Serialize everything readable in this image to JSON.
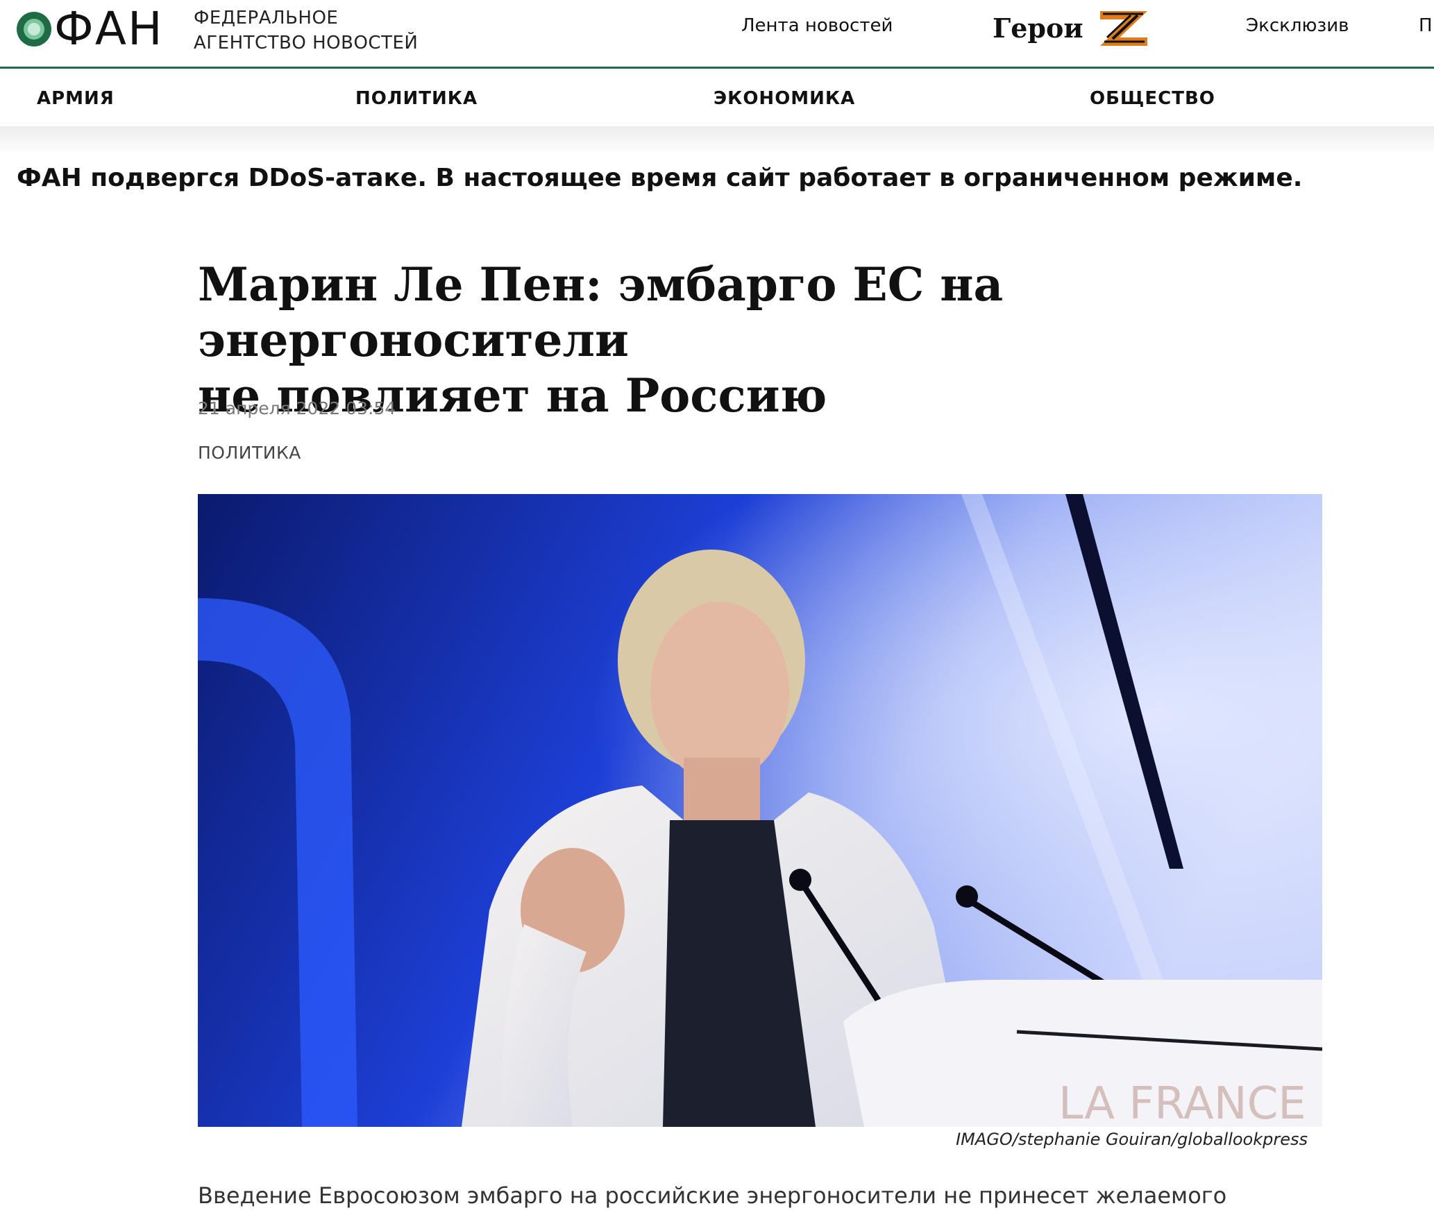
{
  "header": {
    "logo_text": "ФАН",
    "tagline_line1": "ФЕДЕРАЛЬНОЕ",
    "tagline_line2": "АГЕНТСТВО НОВОСТЕЙ",
    "links": {
      "news_feed": "Лента новостей",
      "heroes": "Герои",
      "exclusive": "Эксклюзив",
      "cut_off": "П"
    },
    "accent_color": "#1f6b45"
  },
  "nav": {
    "items": [
      "АРМИЯ",
      "ПОЛИТИКА",
      "ЭКОНОМИКА",
      "ОБЩЕСТВО"
    ]
  },
  "alert": {
    "text": "ФАН подвергся DDoS-атаке. В настоящее время сайт работает в ограниченном режиме."
  },
  "article": {
    "title_line1": "Марин Ле Пен: эмбарго ЕС на энергоносители",
    "title_line2": "не повлияет на Россию",
    "date": "21 апреля 2022 03:54",
    "rubric": "ПОЛИТИКА",
    "photo_sign_text": "LA FRANCE OU",
    "photo_caption": "IMAGO/stephanie Gouiran/globallookpress",
    "lead_text": "Введение Евросоюзом эмбарго на российские энергоносители не принесет желаемого"
  }
}
